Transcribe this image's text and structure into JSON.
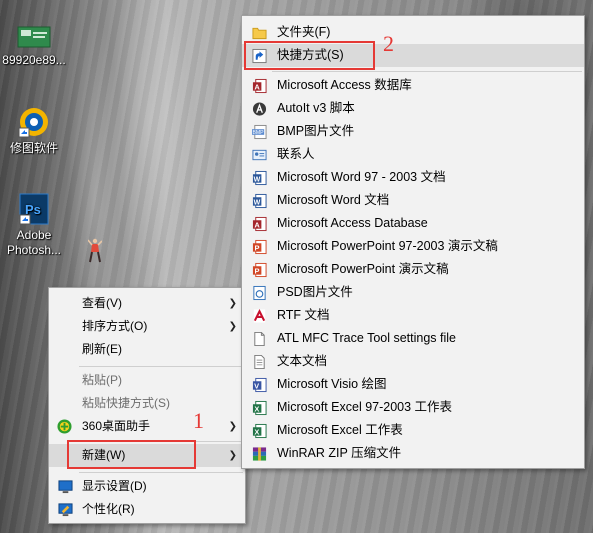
{
  "desktop": {
    "icons": [
      {
        "label": "89920e89...",
        "icon": "image-file-icon"
      },
      {
        "label": "修图软件",
        "icon": "photo-app-icon"
      },
      {
        "label": "Adobe",
        "label2": "Photosh...",
        "icon": "photoshop-icon"
      }
    ]
  },
  "context_menu": {
    "items": [
      {
        "label": "查看(V)",
        "submenu": true
      },
      {
        "label": "排序方式(O)",
        "submenu": true
      },
      {
        "label": "刷新(E)"
      },
      {
        "label": "粘贴(P)",
        "disabled": true
      },
      {
        "label": "粘贴快捷方式(S)",
        "disabled": true
      },
      {
        "label": "360桌面助手",
        "submenu": true,
        "icon": "360-icon"
      },
      {
        "label": "新建(W)",
        "submenu": true
      },
      {
        "label": "显示设置(D)",
        "icon": "display-icon"
      },
      {
        "label": "个性化(R)",
        "icon": "personalize-icon"
      }
    ]
  },
  "new_submenu": {
    "items": [
      {
        "label": "文件夹(F)",
        "icon": "folder-icon"
      },
      {
        "label": "快捷方式(S)",
        "icon": "shortcut-icon"
      },
      {
        "label": "Microsoft Access 数据库",
        "icon": "access-icon"
      },
      {
        "label": "AutoIt v3 脚本",
        "icon": "autoit-icon"
      },
      {
        "label": "BMP图片文件",
        "icon": "bmp-icon"
      },
      {
        "label": "联系人",
        "icon": "contact-icon"
      },
      {
        "label": "Microsoft Word 97 - 2003 文档",
        "icon": "word-icon"
      },
      {
        "label": "Microsoft Word 文档",
        "icon": "word-icon"
      },
      {
        "label": "Microsoft Access Database",
        "icon": "access-icon"
      },
      {
        "label": "Microsoft PowerPoint 97-2003 演示文稿",
        "icon": "powerpoint-icon"
      },
      {
        "label": "Microsoft PowerPoint 演示文稿",
        "icon": "powerpoint-icon"
      },
      {
        "label": "PSD图片文件",
        "icon": "psd-icon"
      },
      {
        "label": "RTF 文档",
        "icon": "rtf-icon"
      },
      {
        "label": "ATL MFC Trace Tool settings file",
        "icon": "settings-file-icon"
      },
      {
        "label": "文本文档",
        "icon": "text-file-icon"
      },
      {
        "label": "Microsoft Visio 绘图",
        "icon": "visio-icon"
      },
      {
        "label": "Microsoft Excel 97-2003 工作表",
        "icon": "excel-icon"
      },
      {
        "label": "Microsoft Excel 工作表",
        "icon": "excel-icon"
      },
      {
        "label": "WinRAR ZIP 压缩文件",
        "icon": "winrar-icon"
      }
    ]
  },
  "annotations": {
    "step1": "1",
    "step2": "2"
  },
  "colors": {
    "annotation": "#e53935",
    "menu_bg": "#f2f2f2",
    "hover_bg": "#dadada"
  }
}
